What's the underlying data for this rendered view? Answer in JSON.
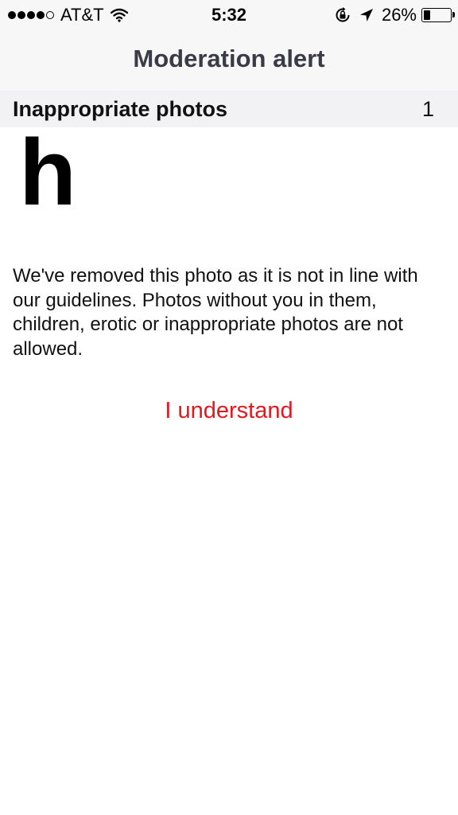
{
  "status_bar": {
    "carrier": "AT&T",
    "time": "5:32",
    "battery_percent": "26%",
    "signal_bars_filled": 4,
    "signal_bars_total": 5,
    "battery_level": 0.26
  },
  "nav": {
    "title": "Moderation alert"
  },
  "section": {
    "title": "Inappropriate photos",
    "count": "1"
  },
  "photo": {
    "placeholder_letter": "h"
  },
  "message": {
    "text": "We've removed this photo as it is not in line with our guidelines. Photos without you in them, children, erotic or inappropriate photos are not allowed."
  },
  "actions": {
    "understand_label": "I understand"
  },
  "colors": {
    "accent": "#e3181f",
    "nav_title": "#3b3b48",
    "bar_background": "#f7f7f8",
    "section_background": "#f2f2f5"
  },
  "icons": [
    "wifi-icon",
    "rotation-lock-icon",
    "location-arrow-icon",
    "battery-icon"
  ]
}
